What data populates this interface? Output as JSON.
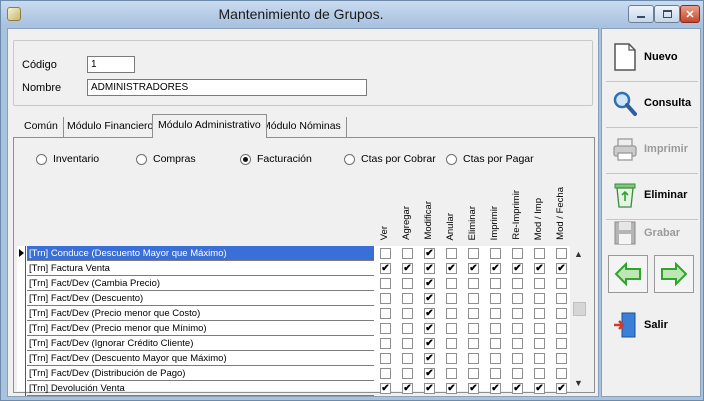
{
  "window": {
    "title": "Mantenimiento de Grupos."
  },
  "form": {
    "codigo_label": "Código",
    "codigo_value": "1",
    "nombre_label": "Nombre",
    "nombre_value": "ADMINISTRADORES"
  },
  "tabs": [
    {
      "label": "Común",
      "active": false
    },
    {
      "label": "Módulo Financiero",
      "active": false
    },
    {
      "label": "Módulo Administrativo",
      "active": true
    },
    {
      "label": "Módulo Nóminas",
      "active": false
    }
  ],
  "radios": [
    {
      "label": "Inventario",
      "selected": false
    },
    {
      "label": "Compras",
      "selected": false
    },
    {
      "label": "Facturación",
      "selected": true
    },
    {
      "label": "Ctas por Cobrar",
      "selected": false
    },
    {
      "label": "Ctas por Pagar",
      "selected": false
    }
  ],
  "columns": [
    "Ver",
    "Agregar",
    "Modificar",
    "Anular",
    "Eliminar",
    "Imprimir",
    "Re-Imprimir",
    "Mod / Imp",
    "Mod / Fecha"
  ],
  "rows": [
    {
      "name": "[Trn] Conduce (Descuento Mayor que Máximo)",
      "selected": true,
      "checks": [
        0,
        0,
        1,
        0,
        0,
        0,
        0,
        0,
        0
      ]
    },
    {
      "name": "[Trn] Factura Venta",
      "selected": false,
      "checks": [
        1,
        1,
        1,
        1,
        1,
        1,
        1,
        1,
        1
      ]
    },
    {
      "name": "[Trn] Fact/Dev (Cambia Precio)",
      "selected": false,
      "checks": [
        0,
        0,
        1,
        0,
        0,
        0,
        0,
        0,
        0
      ]
    },
    {
      "name": "[Trn] Fact/Dev (Descuento)",
      "selected": false,
      "checks": [
        0,
        0,
        1,
        0,
        0,
        0,
        0,
        0,
        0
      ]
    },
    {
      "name": "[Trn] Fact/Dev (Precio menor que Costo)",
      "selected": false,
      "checks": [
        0,
        0,
        1,
        0,
        0,
        0,
        0,
        0,
        0
      ]
    },
    {
      "name": "[Trn] Fact/Dev (Precio menor que Mínimo)",
      "selected": false,
      "checks": [
        0,
        0,
        1,
        0,
        0,
        0,
        0,
        0,
        0
      ]
    },
    {
      "name": "[Trn] Fact/Dev (Ignorar Crédito Cliente)",
      "selected": false,
      "checks": [
        0,
        0,
        1,
        0,
        0,
        0,
        0,
        0,
        0
      ]
    },
    {
      "name": "[Trn] Fact/Dev (Descuento Mayor que Máximo)",
      "selected": false,
      "checks": [
        0,
        0,
        1,
        0,
        0,
        0,
        0,
        0,
        0
      ]
    },
    {
      "name": "[Trn] Fact/Dev (Distribución de Pago)",
      "selected": false,
      "checks": [
        0,
        0,
        1,
        0,
        0,
        0,
        0,
        0,
        0
      ]
    },
    {
      "name": "[Trn] Devolución Venta",
      "selected": false,
      "checks": [
        1,
        1,
        1,
        1,
        1,
        1,
        1,
        1,
        1
      ]
    }
  ],
  "buttons": {
    "nuevo": "Nuevo",
    "consulta": "Consulta",
    "imprimir": "Imprimir",
    "eliminar": "Eliminar",
    "grabar": "Grabar",
    "salir": "Salir"
  },
  "icons": {
    "checkmark": "✔",
    "scroll_up": "▲",
    "scroll_down": "▼"
  },
  "colors": {
    "selection": "#3a6fd8",
    "window_frame": "#a9c3df",
    "nav_arrow": "#2fa52b"
  }
}
